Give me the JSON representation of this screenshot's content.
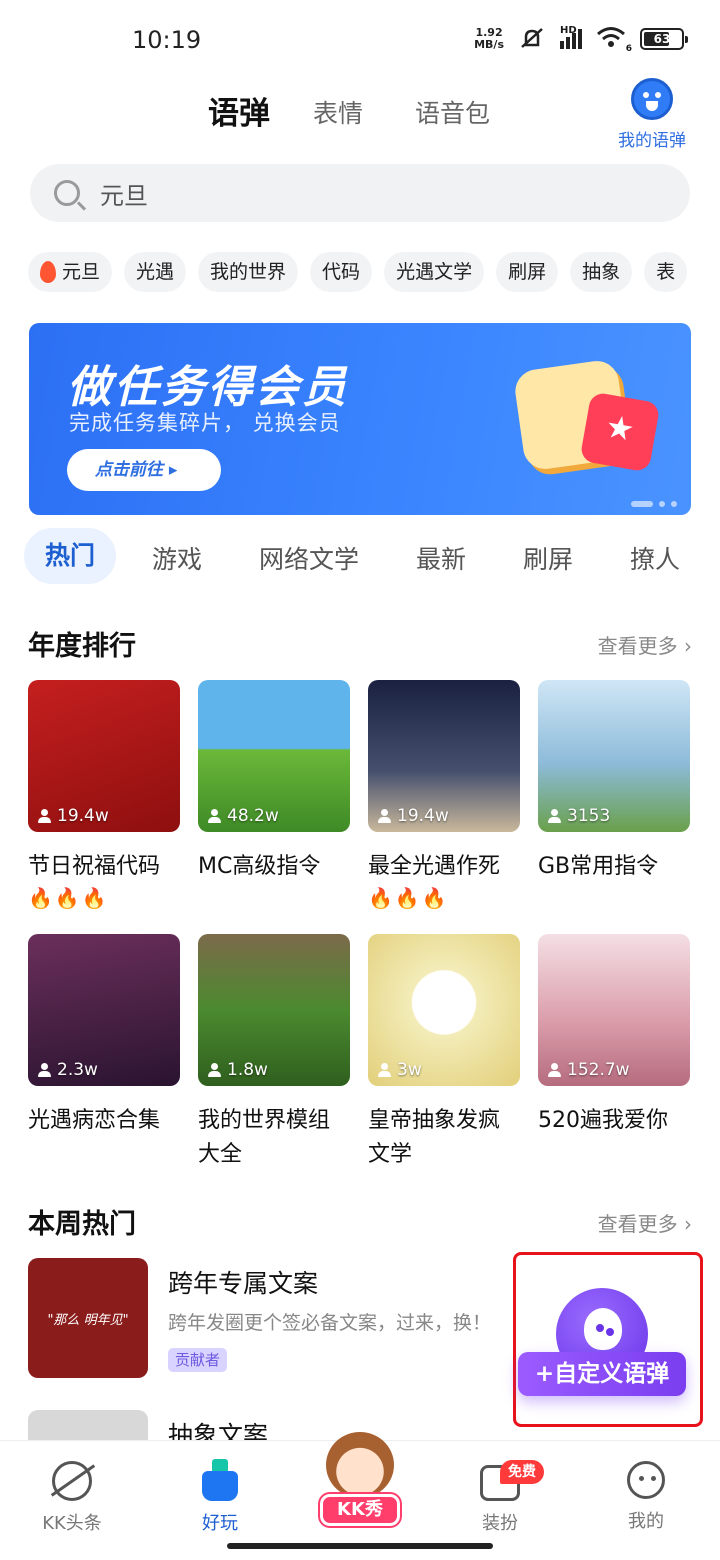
{
  "status_bar": {
    "time": "10:19",
    "net_speed_value": "1.92",
    "net_speed_unit": "MB/s",
    "network": "HD",
    "wifi_level": "6",
    "battery": "63"
  },
  "top_tabs": [
    {
      "label": "语弹",
      "active": true
    },
    {
      "label": "表情",
      "active": false
    },
    {
      "label": "语音包",
      "active": false
    }
  ],
  "my_yudan": {
    "label": "我的语弹",
    "icon": "face-icon"
  },
  "search": {
    "value": "元旦",
    "icon": "search-icon"
  },
  "chips": [
    "元旦",
    "光遇",
    "我的世界",
    "代码",
    "光遇文学",
    "刷屏",
    "抽象",
    "表"
  ],
  "banner": {
    "title": "做任务得会员",
    "subtitle": "完成任务集碎片， 兑换会员",
    "button": "点击前往 ▸",
    "accent": "#2c6ff4"
  },
  "category_tabs": [
    {
      "label": "热门",
      "active": true
    },
    {
      "label": "游戏"
    },
    {
      "label": "网络文学"
    },
    {
      "label": "最新"
    },
    {
      "label": "刷屏"
    },
    {
      "label": "撩人"
    }
  ],
  "annual_ranking": {
    "title": "年度排行",
    "more": "查看更多 ›",
    "items": [
      {
        "title": "节日祝福代码",
        "count": "19.4w",
        "fires": "🔥🔥🔥",
        "color": "#b01818"
      },
      {
        "title": "MC高级指令",
        "count": "48.2w",
        "fires": "",
        "color": "#3f9be0"
      },
      {
        "title": "最全光遇作死",
        "count": "19.4w",
        "fires": "🔥🔥🔥",
        "color": "#2a3550"
      },
      {
        "title": "GB常用指令",
        "count": "3153",
        "fires": "",
        "color": "#7fb2d6"
      },
      {
        "title": "光遇病恋合集",
        "count": "2.3w",
        "fires": "",
        "color": "#5b2a48"
      },
      {
        "title": "我的世界模组大全",
        "count": "1.8w",
        "fires": "",
        "color": "#4c8a2e"
      },
      {
        "title": "皇帝抽象发疯文学",
        "count": "3w",
        "fires": "",
        "color": "#e8dca0"
      },
      {
        "title": "520遍我爱你",
        "count": "152.7w",
        "fires": "",
        "color": "#e8b8c2"
      }
    ]
  },
  "weekly_hot": {
    "title": "本周热门",
    "more": "查看更多 ›",
    "items": [
      {
        "title": "跨年专属文案",
        "desc": "跨年发圈更个签必备文案，过来，换！",
        "badge": "贡献者",
        "thumb_text": "\"那么 明年见\""
      },
      {
        "title": "抽象文案",
        "desc": "",
        "badge": "",
        "thumb_text": ""
      }
    ]
  },
  "fab": {
    "label": "+自定义语弹"
  },
  "bottom_nav": [
    {
      "label": "KK头条",
      "icon": "planet-icon",
      "active": false
    },
    {
      "label": "好玩",
      "icon": "flask-icon",
      "active": true
    },
    {
      "label": "KK秀",
      "icon": "avatar-icon",
      "active": false
    },
    {
      "label": "装扮",
      "icon": "shop-icon",
      "badge": "免费",
      "active": false
    },
    {
      "label": "我的",
      "icon": "face-icon",
      "active": false
    }
  ]
}
